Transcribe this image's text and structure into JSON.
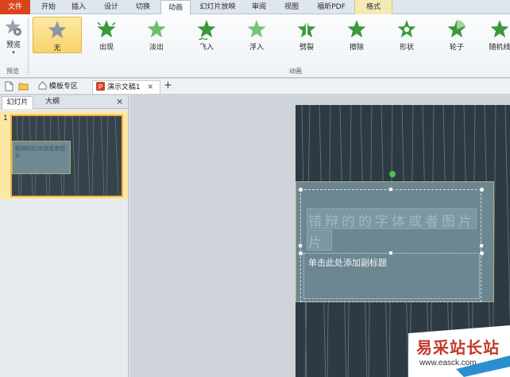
{
  "ribbon_tabs": {
    "file": "文件",
    "home": "开始",
    "insert": "插入",
    "design": "设计",
    "transitions": "切换",
    "animations": "动画",
    "slideshow": "幻灯片放映",
    "review": "审阅",
    "view": "视图",
    "foxit_pdf": "福昕PDF",
    "format": "格式"
  },
  "ribbon": {
    "preview_label": "预览",
    "preview_group": "预览",
    "animation_group": "动画",
    "effects": [
      "无",
      "出现",
      "淡出",
      "飞入",
      "浮入",
      "劈裂",
      "擦除",
      "形状",
      "轮子",
      "随机线"
    ],
    "selected_effect": "无",
    "star_color": "#3a9a3a"
  },
  "doc_tabs": {
    "template_zone": "模板专区",
    "document": "演示文稿1",
    "add": "+"
  },
  "left_panel": {
    "tab_slides": "幻灯片",
    "tab_outline": "大纲",
    "close": "×",
    "slide_number": "1",
    "thumb_title": "精辩的的字体或者图片"
  },
  "slide": {
    "title_text": "错辩的的字体或者图片",
    "title_line2": "片",
    "subtitle_placeholder": "单击此处添加副标题"
  },
  "watermark": {
    "text": "易采站长站",
    "url": "www.easck.com",
    "color": "#c0392b"
  }
}
